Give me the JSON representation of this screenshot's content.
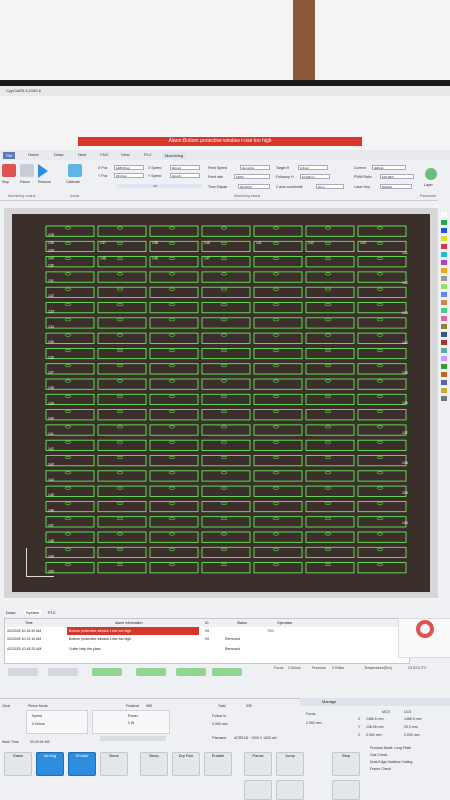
{
  "app": {
    "title": "CypCutE6.4.2150.6",
    "alarm_banner": "Alarm:Bottom protective window t-rise too high"
  },
  "menu": [
    "File",
    "Home",
    "Draw",
    "Nest",
    "CNC",
    "View",
    "PLC",
    "Machining"
  ],
  "menu_active": "Machining",
  "ribbon": {
    "buttons": [
      "Stop",
      "Pause",
      "Resume",
      "Calibrate"
    ],
    "xpos_label": "X Pos",
    "xpos": "1486.5mm",
    "ypos_label": "Y Pos",
    "ypos": "20.3mm",
    "xspeed_label": "X Speed",
    "xspeed": "0mm/s",
    "yspeed_label": "Y Speed",
    "yspeed": "0mm/s",
    "feed_speed_label": "Feed Speed",
    "feed_speed": "0mm/min",
    "feed_rate_label": "Feed rate",
    "feed_rate": "100%",
    "time_elapse_label": "Time Elapse",
    "time_elapse": "00:00:04",
    "target_h_label": "Target H",
    "target_h": "0.4mm",
    "followup_label": "Followup H",
    "followup": "10.00mm",
    "zaxis_label": "Z axis coordinate",
    "zaxis": "0mm",
    "current_label": "Current",
    "current": "400mA",
    "pwm_label": "PWM Ratio",
    "pwm": "100.00%",
    "laser_freq_label": "Laser freq",
    "laser_freq": "5000Hz",
    "layer_label": "Layer",
    "section_control": "Machining control",
    "section_assist": "Assist",
    "section_status": "Machining status",
    "section_param": "Parameter",
    "ok_label": "OK"
  },
  "canvas": {
    "cols": [
      "136",
      "137",
      "138",
      "140",
      "141",
      "142",
      "143",
      "144",
      "145",
      "146",
      "147"
    ],
    "left_labels": [
      "128",
      "129",
      "130",
      "131",
      "132",
      "133",
      "134",
      "135",
      "136",
      "137",
      "138",
      "139",
      "140",
      "141",
      "142",
      "143",
      "144",
      "145",
      "146",
      "147",
      "148",
      "149",
      "150"
    ],
    "right_labels": [
      "131",
      "132",
      "133",
      "134",
      "135",
      "136",
      "137",
      "138",
      "139",
      "140"
    ]
  },
  "layer_colors": [
    "#ffffff",
    "#22aa44",
    "#2255dd",
    "#dddd22",
    "#dd3344",
    "#22bbcc",
    "#aa44cc",
    "#ffa500",
    "#999999",
    "#99dd66",
    "#6688ee",
    "#cc8844",
    "#44cc88",
    "#dd66aa",
    "#888833",
    "#335588",
    "#aa3322",
    "#55aaaa",
    "#cc99ff",
    "#339933",
    "#bb6622",
    "#5566aa",
    "#ccaa33",
    "#777777"
  ],
  "log": {
    "tabs": [
      "Draw",
      "System",
      "PLC"
    ],
    "columns": [
      "Time",
      "Alarm information",
      "ID",
      "Status",
      "Operation"
    ],
    "rows": [
      {
        "time": "4/2/2025 10:15:20 AM",
        "info": "Bottom protective window t-rise too high",
        "id": "94",
        "status": "",
        "op": "",
        "alarm": true
      },
      {
        "time": "4/2/2025 10:12:10 AM",
        "info": "Bottom protective window t-rise too high",
        "id": "94",
        "status": "Removed",
        "op": "",
        "alarm": false
      },
      {
        "time": "4/2/2025 10:18:20 AM",
        "info": "Cutter help the plate",
        "id": "",
        "status": "Removed",
        "op": "",
        "alarm": false
      }
    ],
    "operation_top": "TBD"
  },
  "statusbar": {
    "focus_label": "Focus",
    "focus": "2.00mm",
    "pressure_label": "Pressure",
    "pressure": "0.00Bar",
    "temp_label": "Temperature(Env)",
    "temp": "23.0/23.3°C"
  },
  "bottom": {
    "clear_label": "Clear",
    "mode_label": "Pierce Mode",
    "finished_label": "Finished",
    "finished": "965",
    "total_label": "Total",
    "total": "335",
    "speed_label": "Speed",
    "speed": "0.00mm",
    "power_label": "Power",
    "power": "0 W",
    "followin_label": "Follow in",
    "followin": "0.400 mm",
    "focus_label": "Focus",
    "focus": "2.000 mm",
    "filename_label": "Filename",
    "filename": "ACRELB · 1300 X 1000.dxf",
    "worktime_label": "Work Time",
    "worktime": "00:00:04 M3",
    "manage": "Manage",
    "coords_head": [
      "MCS",
      "UCS"
    ],
    "coords": [
      {
        "axis": "X",
        "mcs": "1486.5 mm",
        "ucs": "1486.5 mm"
      },
      {
        "axis": "Y",
        "mcs": "128.95 mm",
        "ucs": "20.3 mm"
      },
      {
        "axis": "Z",
        "mcs": "0.000 mm",
        "ucs": "0.000 mm"
      }
    ],
    "options": [
      "Process Mode: Long Plate",
      "Gas Check",
      "Dual-Edge Swallow Cutting",
      "Frame Check"
    ],
    "tiles": [
      "Gasin",
      "Aiming",
      "Shutter",
      "Burst",
      "Beep",
      "Dry Run",
      "Enable",
      "Pause",
      "Jump",
      "Step"
    ]
  }
}
